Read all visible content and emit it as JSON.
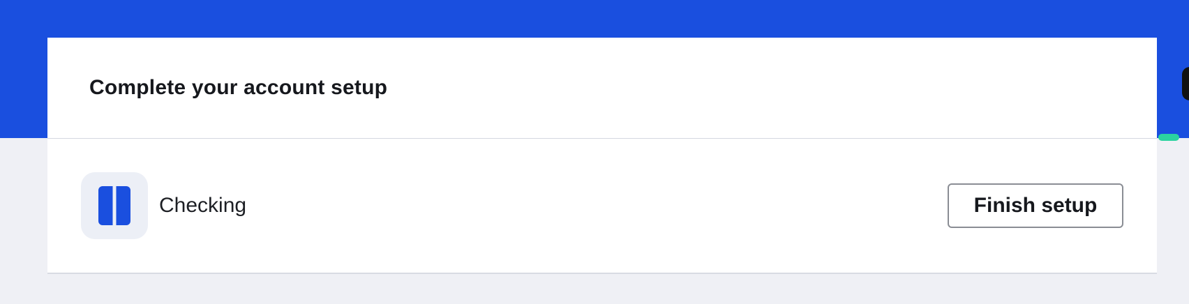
{
  "setup_card": {
    "title": "Complete your account setup",
    "account": {
      "name": "Checking",
      "icon": "checking-account-icon"
    },
    "finish_button_label": "Finish setup"
  },
  "colors": {
    "hero_background": "#1a4fdf",
    "page_background": "#eff0f5",
    "icon_tile_background": "#eceff6",
    "icon_color": "#1a4fdf"
  }
}
